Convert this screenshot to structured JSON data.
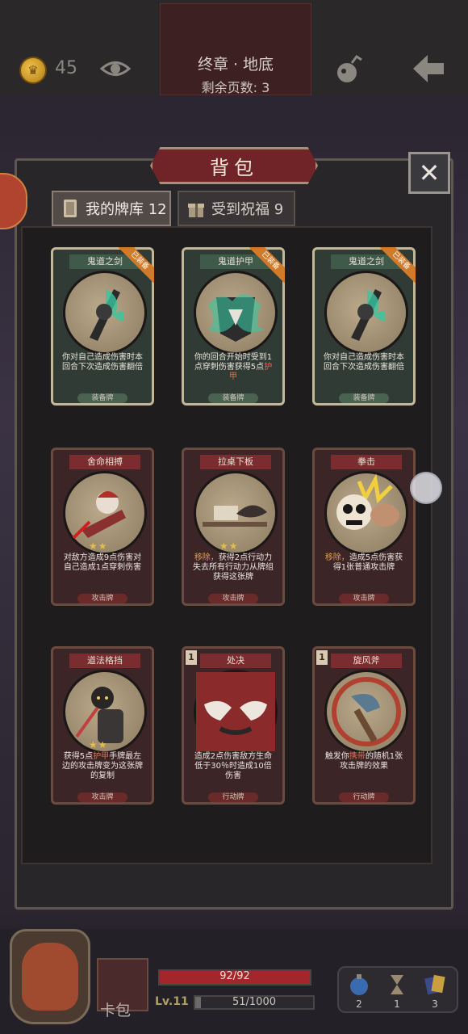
{
  "header": {
    "coins": "45",
    "chapter_title": "终章 · 地底",
    "pages_left": "剩余页数: 3",
    "icons": [
      "coin-icon",
      "eye-icon",
      "bomb-icon",
      "back-arrow-icon"
    ]
  },
  "bag": {
    "title": "背包",
    "close_icon": "close-icon",
    "tabs": [
      {
        "label": "我的牌库 12",
        "icon": "card-deck-icon",
        "active": true
      },
      {
        "label": "受到祝福 9",
        "icon": "gift-icon",
        "active": false
      }
    ]
  },
  "cards": [
    {
      "title": "鬼道之剑",
      "badge": "已装备",
      "style": "green",
      "desc": "你对自己造成伤害时本回合下次造成伤害翻倍",
      "type": "装备牌"
    },
    {
      "title": "鬼道护甲",
      "badge": "已装备",
      "style": "green",
      "desc": "你的回合开始时受到1点穿刺伤害获得5点",
      "desc_hl": "护甲",
      "type": "装备牌"
    },
    {
      "title": "鬼道之剑",
      "badge": "已装备",
      "style": "green",
      "desc": "你对自己造成伤害时本回合下次造成伤害翻倍",
      "type": "装备牌"
    },
    {
      "title": "舍命相搏",
      "stars": "★★",
      "style": "red",
      "desc": "对敌方造成9点伤害对自己造成1点穿刺伤害",
      "type": "攻击牌"
    },
    {
      "title": "拉桌下板",
      "stars": "★★",
      "style": "red",
      "desc_hl": "移除，",
      "desc": "获得2点行动力失去所有行动力从牌组获得这张牌",
      "type": "攻击牌"
    },
    {
      "title": "拳击",
      "style": "red",
      "desc_hl": "移除，",
      "desc": "造成5点伤害获得1张普通攻击牌",
      "type": "攻击牌"
    },
    {
      "title": "道法格挡",
      "stars": "★★",
      "style": "red",
      "desc": "获得5点",
      "desc_hl": "护甲",
      "desc2": "手牌最左边的攻击牌变为这张牌的复制",
      "type": "攻击牌"
    },
    {
      "title": "处决",
      "level": "1",
      "style": "red",
      "desc": "造成2点伤害敌方生命低于30％时造成10倍伤害",
      "type": "行动牌"
    },
    {
      "title": "旋风斧",
      "level": "1",
      "style": "red",
      "desc": "触发你",
      "desc_hl": "携带",
      "desc2": "的随机1张攻击牌的效果",
      "type": "行动牌"
    }
  ],
  "footer": {
    "card_bag_label": "卡包",
    "hp_text": "92/92",
    "hp_fraction": 1.0,
    "level": "Lv.11",
    "xp_text": "51/1000",
    "xp_fraction": 0.051,
    "inventory": [
      {
        "icon": "potion-icon",
        "count": "2"
      },
      {
        "icon": "hourglass-icon",
        "count": "1"
      },
      {
        "icon": "cards-icon",
        "count": "3"
      }
    ]
  },
  "colors": {
    "accent_red": "#702427",
    "equip_orange": "#d07a2a",
    "hp_red": "#a3262a",
    "star_gold": "#e2bd4a"
  }
}
